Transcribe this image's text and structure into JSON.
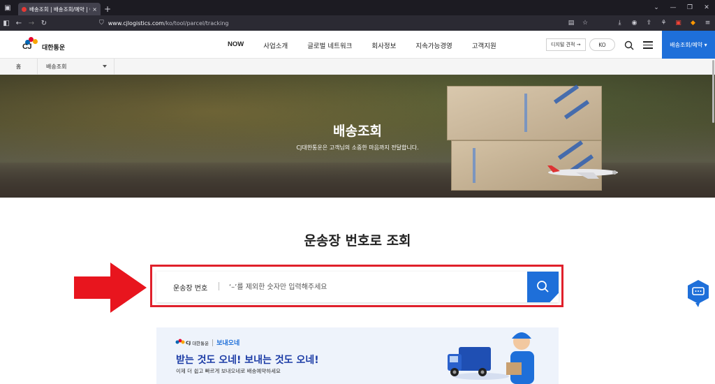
{
  "browser": {
    "tab_title": "배송조회 | 배송조회/예약 | CJ대",
    "tab_close": "×",
    "new_tab": "+",
    "url_host": "www.cjlogistics.com",
    "url_path": "/ko/tool/parcel/tracking"
  },
  "header": {
    "logo_text": "대한통운",
    "logo_cj": "CJ",
    "nav": [
      "NOW",
      "사업소개",
      "글로벌 네트워크",
      "회사정보",
      "지속가능경영",
      "고객지원"
    ],
    "digital_quote": "디지털 견적 →",
    "lang": "KO",
    "delivery_menu": "배송조회/예약 ▾"
  },
  "breadcrumb": {
    "home": "홈",
    "current": "배송조회"
  },
  "hero": {
    "title": "배송조회",
    "subtitle": "CJ대한통운은 고객님의 소중한 마음까지 전달합니다."
  },
  "tracking": {
    "title": "운송장 번호로 조회",
    "label": "운송장 번호",
    "placeholder": "‘–’를 제외한 숫자만 입력해주세요"
  },
  "banner": {
    "brand": "대한통운",
    "brand_cj": "CJ",
    "service": "보내오네",
    "headline": "받는 것도 오네! 보내는 것도 오네!",
    "desc": "이제 더 쉽고 빠르게 보내오네로 배송예약하세요"
  },
  "colors": {
    "primary": "#1e6fd9",
    "highlight": "#e0202b",
    "banner_bg": "#eef3fb"
  }
}
